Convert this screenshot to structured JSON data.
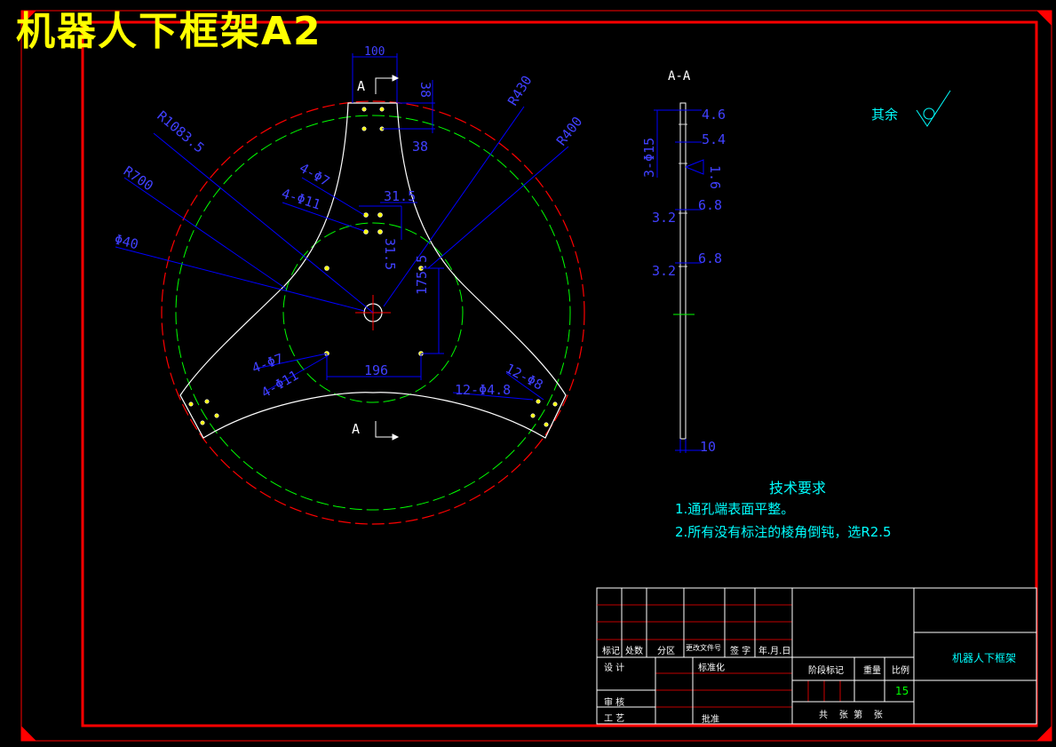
{
  "title": "机器人下框架A2",
  "views": {
    "section_mark_top": "A",
    "section_mark_bottom": "A",
    "section_title": "A-A"
  },
  "dims": {
    "d100": "100",
    "d38v": "38",
    "d38h": "38",
    "r430": "R430",
    "r400": "R400",
    "r1083": "R1083.5",
    "r700": "R700",
    "phi40": "Φ40",
    "h4_7a": "4-Φ7",
    "h4_11a": "4-Φ11",
    "d31_5h": "31.5",
    "d31_5v": "31.5",
    "d175_5": "175.5",
    "h4_7b": "4-Φ7",
    "h4_11b": "4-Φ11",
    "d196": "196",
    "h12_4_8": "12-Φ4.8",
    "h12_8": "12-Φ8"
  },
  "section_dims": {
    "d4_6": "4.6",
    "d5_4": "5.4",
    "h3_15": "3-Φ15",
    "rough": "1.6",
    "d3_2a": "3.2",
    "d6_8a": "6.8",
    "d3_2b": "3.2",
    "d6_8b": "6.8",
    "d10": "10"
  },
  "roughness_note": "其余",
  "tech": {
    "heading": "技术要求",
    "line1": "1.通孔端表面平整。",
    "line2": "2.所有没有标注的棱角倒钝，选R2.5"
  },
  "titleblock": {
    "c_mark": "标记",
    "c_count": "处数",
    "c_zone": "分区",
    "c_docno": "更改文件号",
    "c_sign": "签 字",
    "c_date": "年.月.日",
    "design": "设 计",
    "standard": "标准化",
    "review": "审 核",
    "process": "工 艺",
    "approve": "批准",
    "stage": "阶段标记",
    "weight": "重量",
    "scale": "比例",
    "scale_value": "15",
    "sheets": "共    张  第    张",
    "part_name": "机器人下框架"
  },
  "colors": {
    "frame": "#ff0000",
    "outline": "#ffffff",
    "center": "#00ff00",
    "dim": "#0000ff",
    "dimtext": "#4040ff",
    "note": "#00ffff",
    "title": "#ffff00"
  }
}
